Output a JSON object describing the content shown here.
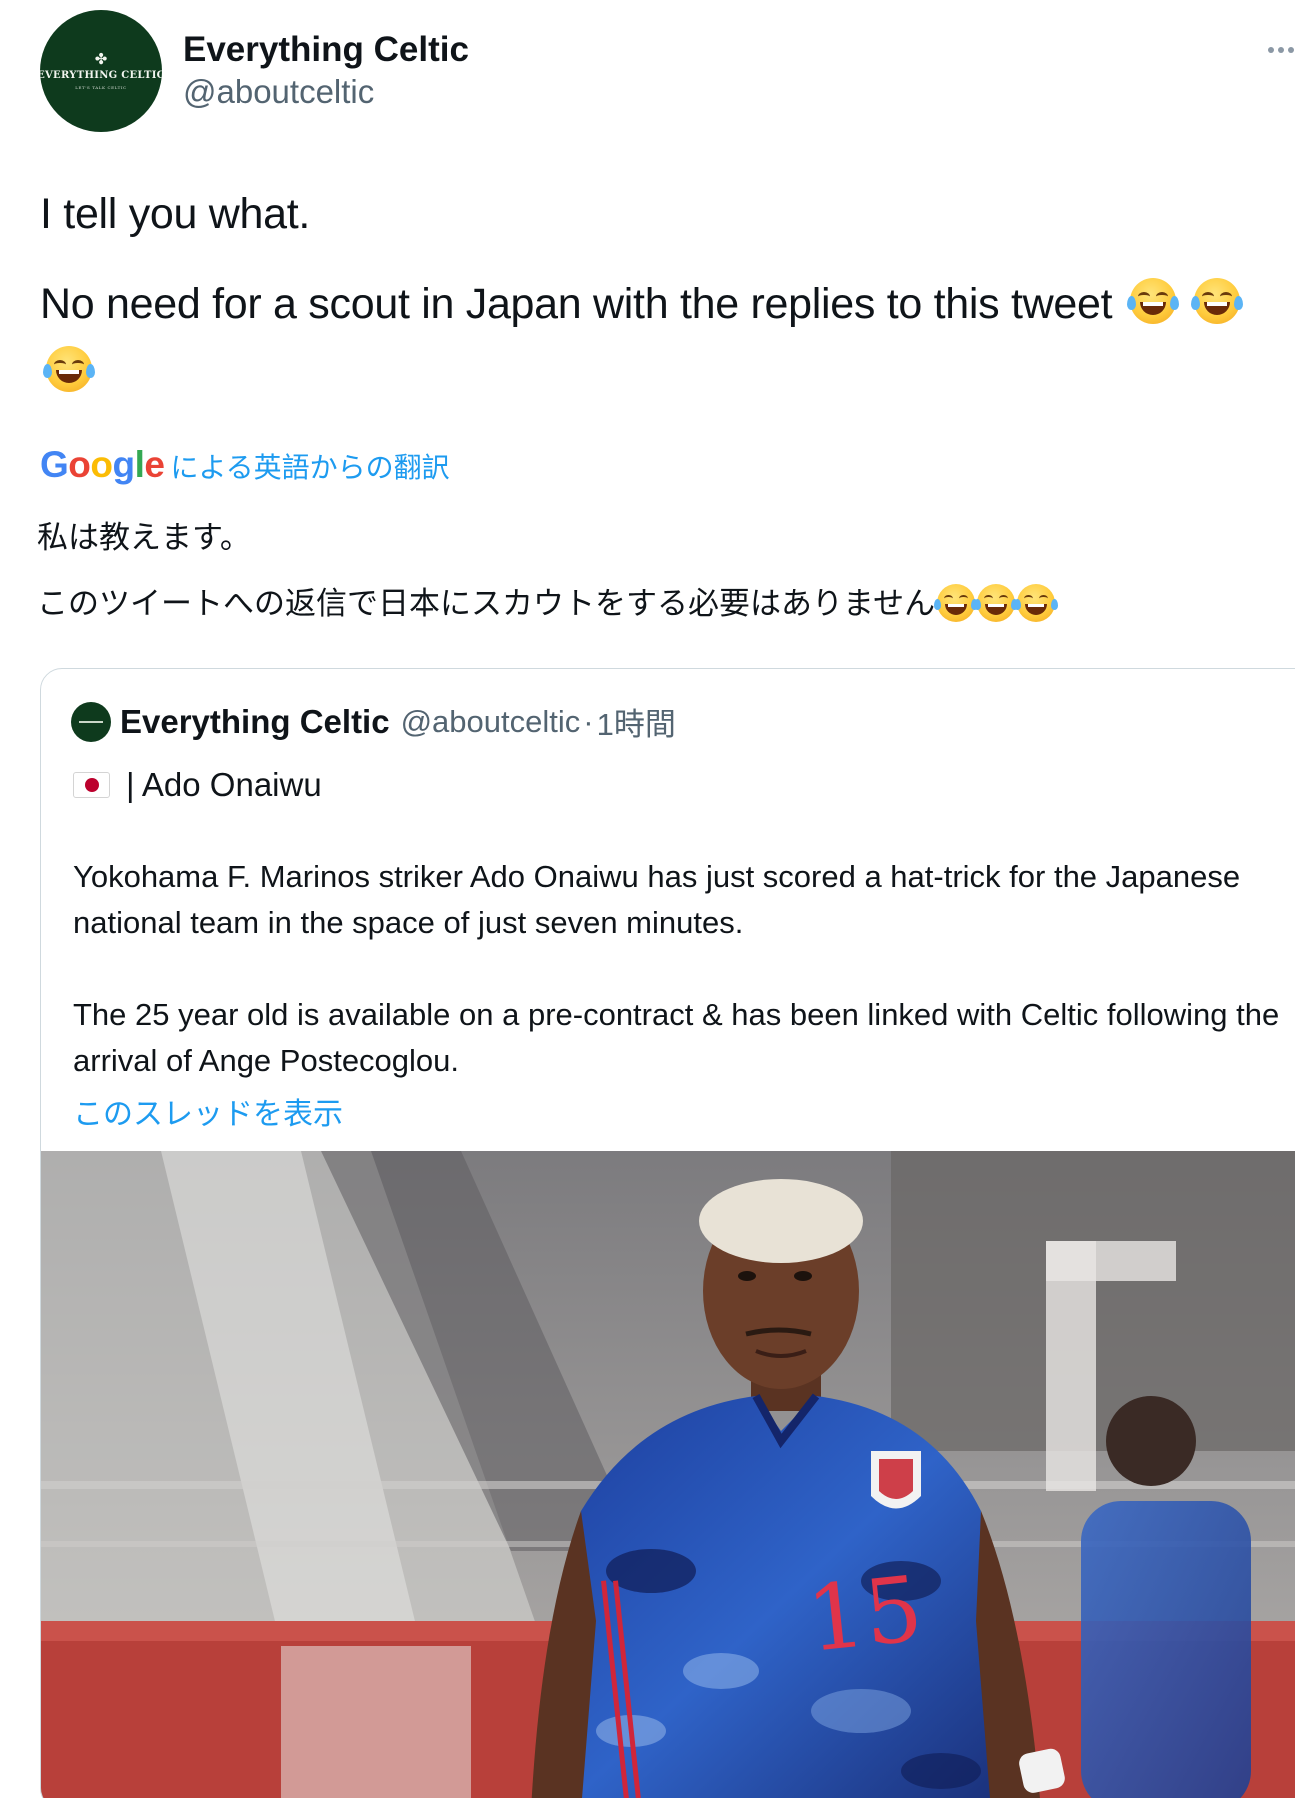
{
  "author": {
    "display_name": "Everything Celtic",
    "handle": "@aboutceltic",
    "avatar_title": "EVERYTHING CELTIC",
    "avatar_subtitle": "LET'S TALK CELTIC"
  },
  "icons": {
    "more": "more-horizontal-icon",
    "emoji": "face-with-tears-of-joy-icon",
    "flag": "japan-flag-icon"
  },
  "tweet": {
    "line1": "I tell you what.",
    "line2": "No need for a scout in Japan with the replies to this tweet"
  },
  "translation": {
    "google_logo": "Google",
    "link_label": "による英語からの翻訳",
    "line1": "私は教えます。",
    "line2": "このツイートへの返信で日本にスカウトをする必要はありません"
  },
  "quoted_tweet": {
    "display_name": "Everything Celtic",
    "handle": "@aboutceltic",
    "separator": "·",
    "time": "1時間",
    "headline": "| Ado Onaiwu",
    "paragraph1": "Yokohama F. Marinos striker Ado Onaiwu has just scored a hat-trick for the Japanese national team in the space of just seven minutes.",
    "paragraph2": "The 25 year old is available on a pre-contract & has been linked with Celtic following the arrival of Ange Postecoglou.",
    "show_thread": "このスレッドを表示",
    "jersey_number": "15"
  },
  "colors": {
    "link": "#1d9bf0",
    "text": "#0f1419",
    "muted": "#536471",
    "avatar_green": "#0e3a1d"
  }
}
